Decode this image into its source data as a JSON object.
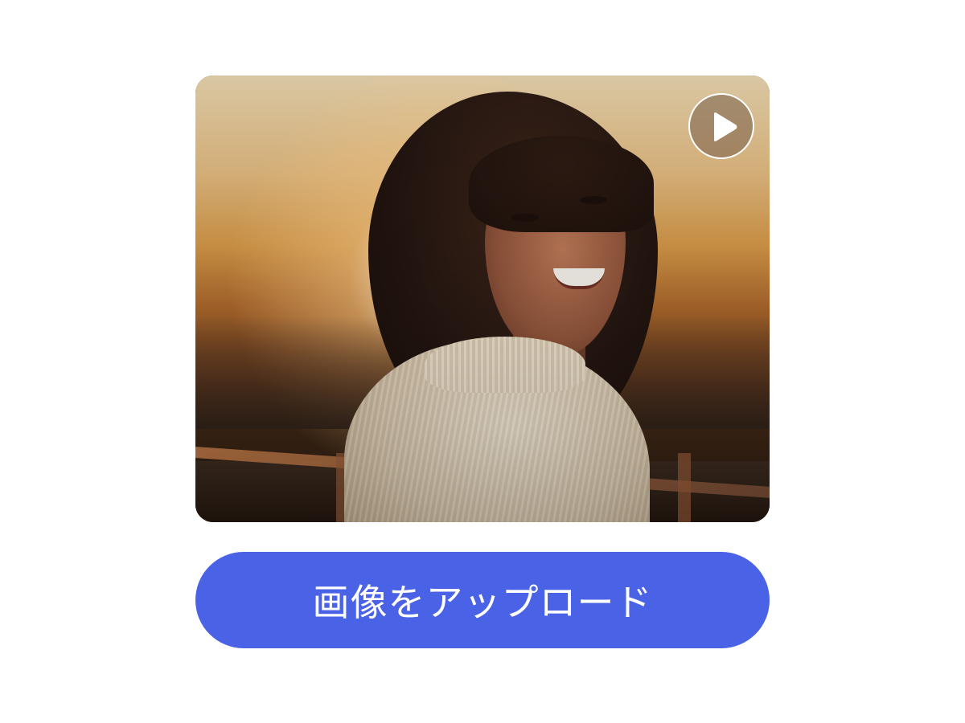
{
  "media": {
    "image_description_icon": "photo-thumbnail",
    "play_icon": "play-icon"
  },
  "actions": {
    "upload_label": "画像をアップロード"
  },
  "colors": {
    "primary_button": "#4a63e6",
    "background": "#ffffff",
    "button_text": "#ffffff"
  }
}
